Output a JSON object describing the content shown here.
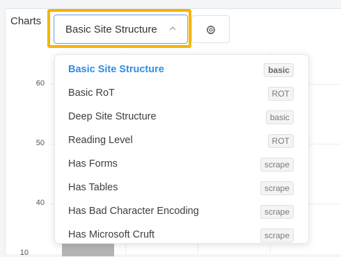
{
  "toolbar": {
    "label": "Charts",
    "selected_chart": "Basic Site Structure",
    "highlight_color": "#f5b400"
  },
  "chart": {
    "y_ticks": [
      "60",
      "50",
      "40",
      "10"
    ]
  },
  "dropdown": {
    "items": [
      {
        "label": "Basic Site Structure",
        "badge": "basic",
        "selected": true
      },
      {
        "label": "Basic RoT",
        "badge": "ROT",
        "selected": false
      },
      {
        "label": "Deep Site Structure",
        "badge": "basic",
        "selected": false
      },
      {
        "label": "Reading Level",
        "badge": "ROT",
        "selected": false
      },
      {
        "label": "Has Forms",
        "badge": "scrape",
        "selected": false
      },
      {
        "label": "Has Tables",
        "badge": "scrape",
        "selected": false
      },
      {
        "label": "Has Bad Character Encoding",
        "badge": "scrape",
        "selected": false
      },
      {
        "label": "Has Microsoft Cruft",
        "badge": "scrape",
        "selected": false
      }
    ],
    "selected_color": "#2f8ee5"
  },
  "icons": {
    "dropdown_toggle": "chevron-up-icon",
    "settings": "gear-icon"
  }
}
